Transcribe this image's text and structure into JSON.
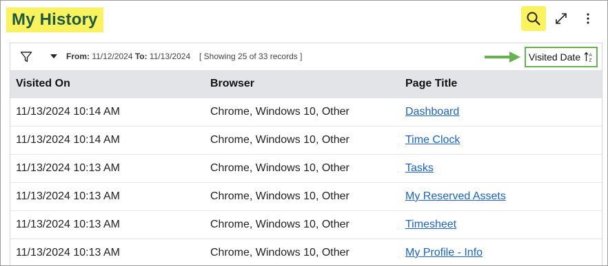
{
  "header": {
    "title": "My History",
    "search_icon": "search-icon",
    "expand_icon": "expand-icon",
    "more_icon": "more-vertical-icon",
    "highlight_color": "#fbf35d",
    "title_color": "#1d5a45"
  },
  "toolbar": {
    "filter_icon": "filter-icon",
    "caret_icon": "caret-down-icon",
    "from_label": "From:",
    "from_value": "11/12/2024",
    "to_label": "To:",
    "to_value": "11/13/2024",
    "showing": "[ Showing 25 of 33 records ]",
    "sort_label": "Visited Date",
    "sort_icon": "sort-ascending-icon",
    "accent_color": "#64b34e"
  },
  "table": {
    "columns": [
      "Visited On",
      "Browser",
      "Page Title"
    ],
    "rows": [
      {
        "visited_on": "11/13/2024 10:14 AM",
        "browser": "Chrome, Windows 10, Other",
        "page_title": "Dashboard"
      },
      {
        "visited_on": "11/13/2024 10:14 AM",
        "browser": "Chrome, Windows 10, Other",
        "page_title": "Time Clock"
      },
      {
        "visited_on": "11/13/2024 10:13 AM",
        "browser": "Chrome, Windows 10, Other",
        "page_title": "Tasks"
      },
      {
        "visited_on": "11/13/2024 10:13 AM",
        "browser": "Chrome, Windows 10, Other",
        "page_title": "My Reserved Assets"
      },
      {
        "visited_on": "11/13/2024 10:13 AM",
        "browser": "Chrome, Windows 10, Other",
        "page_title": "Timesheet"
      },
      {
        "visited_on": "11/13/2024 10:13 AM",
        "browser": "Chrome, Windows 10, Other",
        "page_title": "My Profile - Info"
      }
    ]
  }
}
